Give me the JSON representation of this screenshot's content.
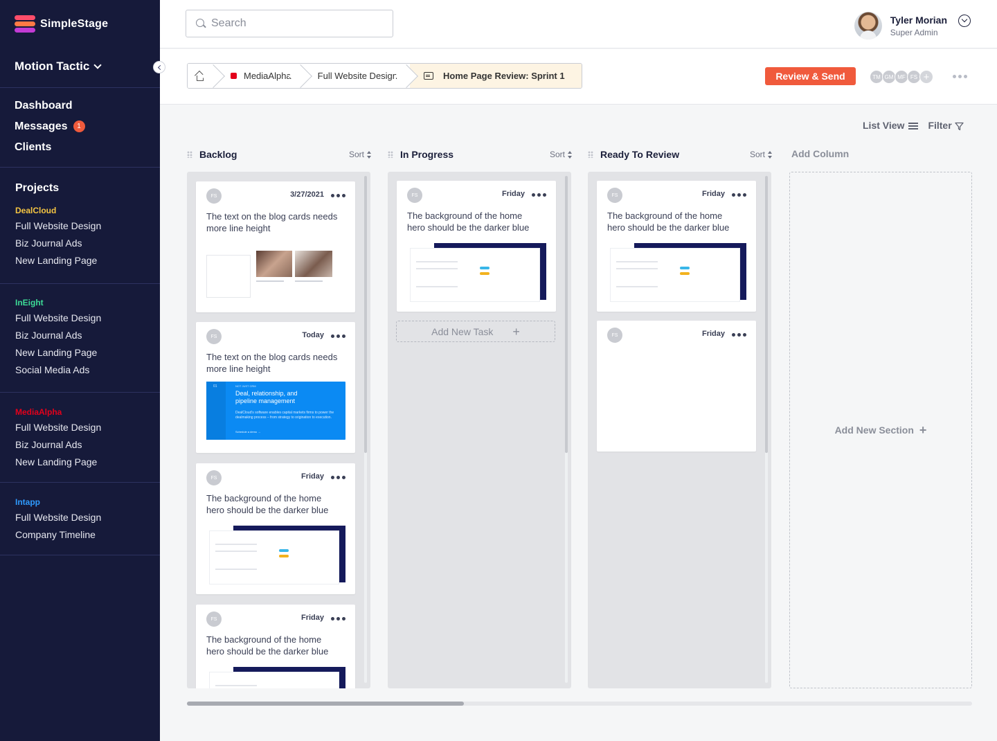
{
  "app": {
    "name": "SimpleStage"
  },
  "org": {
    "name": "Motion Tactic"
  },
  "nav": [
    {
      "label": "Dashboard"
    },
    {
      "label": "Messages",
      "badge": "1"
    },
    {
      "label": "Clients"
    }
  ],
  "projects": {
    "title": "Projects",
    "groups": [
      {
        "name": "DealCloud",
        "color": "#f5c542",
        "items": [
          "Full Website Design",
          "Biz Journal Ads",
          "New Landing Page"
        ]
      },
      {
        "name": "InEight",
        "color": "#3ddc97",
        "items": [
          "Full Website Design",
          "Biz Journal Ads",
          "New Landing Page",
          "Social Media Ads"
        ]
      },
      {
        "name": "MediaAlpha",
        "color": "#e3001b",
        "items": [
          "Full Website Design",
          "Biz Journal Ads",
          "New Landing Page"
        ]
      },
      {
        "name": "Intapp",
        "color": "#2f9bff",
        "items": [
          "Full Website Design",
          "Company Timeline"
        ]
      }
    ]
  },
  "search": {
    "placeholder": "Search"
  },
  "user": {
    "name": "Tyler Morian",
    "role": "Super Admin"
  },
  "breadcrumb": {
    "client": "MediaAlpha",
    "project": "Full Website Design",
    "current": "Home Page Review: Sprint 1"
  },
  "actions": {
    "review_send": "Review & Send"
  },
  "collaborators": [
    "TM",
    "GM",
    "MF",
    "FS"
  ],
  "view": {
    "list_view": "List View",
    "filter": "Filter"
  },
  "columns": [
    {
      "name": "Backlog",
      "sort": "Sort",
      "cards": [
        {
          "initials": "FS",
          "date": "3/27/2021",
          "text": "The text on the blog cards needs more line height",
          "thumb": "blog"
        },
        {
          "initials": "FS",
          "date": "Today",
          "text": "The text on the blog cards needs more line height",
          "thumb": "blue",
          "thumb_title": "Deal, relationship, and pipeline management",
          "thumb_kicker": "NOT JUST CRM",
          "thumb_body": "DealCloud's software enables capital markets firms to power the dealmaking process – from strategy to origination to execution.",
          "thumb_cta": "Schedule a demo →",
          "thumb_index": "01"
        },
        {
          "initials": "FS",
          "date": "Friday",
          "text": "The background of the home hero should be the darker blue",
          "thumb": "dash"
        },
        {
          "initials": "FS",
          "date": "Friday",
          "text": "The background of the home hero should be the darker blue",
          "thumb": "dash"
        }
      ]
    },
    {
      "name": "In Progress",
      "sort": "Sort",
      "cards": [
        {
          "initials": "FS",
          "date": "Friday",
          "text": "The background of the home hero should be the darker blue",
          "thumb": "dash"
        }
      ],
      "add_task": "Add New Task"
    },
    {
      "name": "Ready To Review",
      "sort": "Sort",
      "cards": [
        {
          "initials": "FS",
          "date": "Friday",
          "text": "The background of the home hero should be the darker blue",
          "thumb": "dash"
        },
        {
          "initials": "FS",
          "date": "Friday",
          "text": "",
          "thumb": "none"
        }
      ]
    }
  ],
  "add_column": "Add Column",
  "add_section": "Add New Section"
}
